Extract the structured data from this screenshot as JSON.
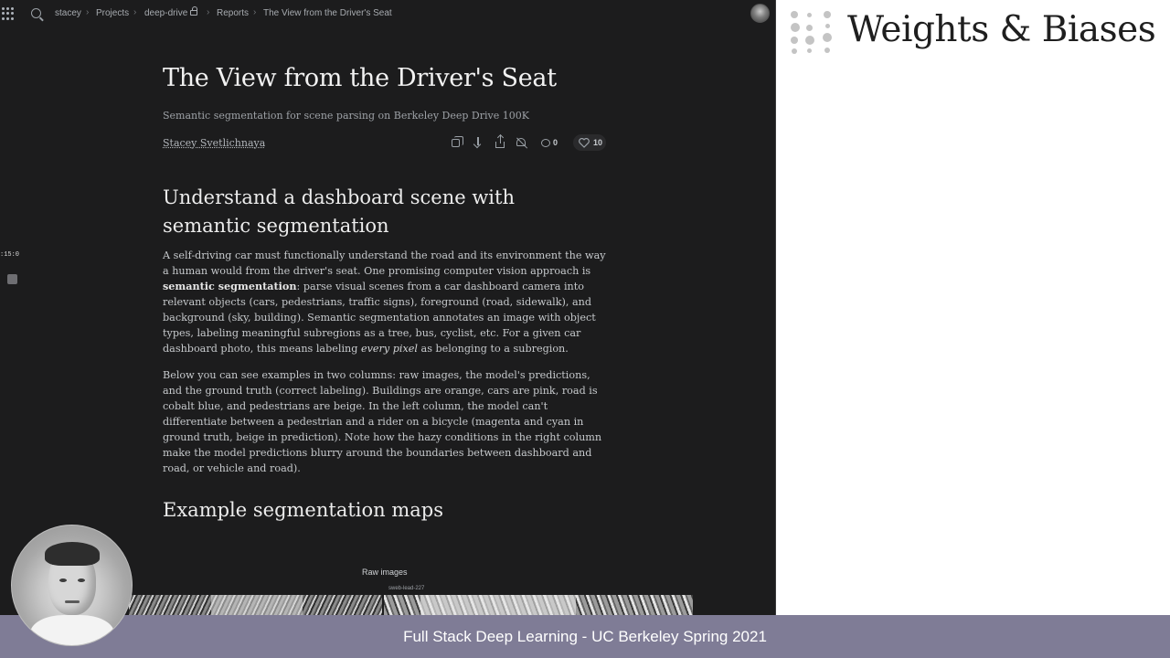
{
  "breadcrumbs": [
    {
      "label": "stacey"
    },
    {
      "label": "Projects"
    },
    {
      "label": "deep-drive"
    },
    {
      "label": "Reports"
    },
    {
      "label": "The View from the Driver's Seat"
    }
  ],
  "report": {
    "title": "The View from the Driver's Seat",
    "subtitle": "Semantic segmentation for scene parsing on Berkeley Deep Drive 100K",
    "author": "Stacey Svetlichnaya",
    "comment_count": "0",
    "like_count": "10",
    "section1_heading_line1": "Understand a dashboard scene with",
    "section1_heading_line2": "semantic segmentation",
    "para1": {
      "part1": "A self-driving car must functionally understand the road and its environment the way a human would from the driver's seat. One promising computer vision approach is ",
      "bold": "semantic segmentation",
      "part2": ": parse visual scenes from a car dashboard camera into relevant objects (cars, pedestrians, traffic signs), foreground (road, sidewalk), and background (sky, building). Semantic segmentation annotates an image with object types, labeling meaningful subregions as a tree, bus, cyclist, etc. For a given car dashboard photo, this means labeling ",
      "italic": "every pixel",
      "part3": " as belonging to a subregion."
    },
    "para2": "Below you can see examples in two columns: raw images, the model's predictions, and the ground truth (correct labeling). Buildings are orange, cars are pink, road is cobalt blue, and pedestrians are beige. In the left column, the model can't differentiate between a pedestrian and a rider on a bicycle (magenta and cyan in ground truth, beige in prediction). Note how the hazy conditions in the right column make the model predictions blurry around the boundaries between dashboard and road, or vehicle and road).",
    "section2_heading": "Example segmentation maps",
    "panel_label": "Raw images",
    "image_caption": "sweb-lead-227"
  },
  "sidebar": {
    "timer": ":15:0"
  },
  "brand": {
    "title": "Weights & Biases"
  },
  "footer": {
    "text": "Full Stack Deep Learning - UC Berkeley Spring 2021"
  },
  "colors": {
    "report_bg": "#1c1c1d",
    "footer_bg": "#7f7c96",
    "logo_dots": "#c4c4c4"
  },
  "icons": [
    "apps-grid-icon",
    "search-icon",
    "lock-icon",
    "avatar",
    "copy-icon",
    "download-icon",
    "share-icon",
    "mute-icon",
    "comment-icon",
    "heart-icon",
    "wandb-logo-icon"
  ]
}
